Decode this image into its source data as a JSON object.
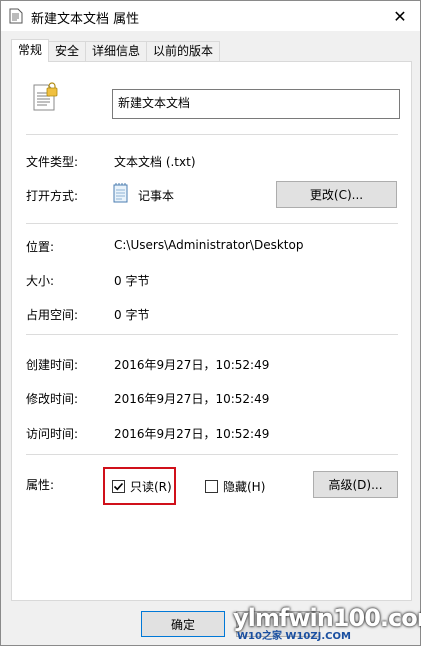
{
  "window": {
    "title": "新建文本文档 属性",
    "close_glyph": "✕"
  },
  "tabs": [
    {
      "label": "常规",
      "active": true
    },
    {
      "label": "安全",
      "active": false
    },
    {
      "label": "详细信息",
      "active": false
    },
    {
      "label": "以前的版本",
      "active": false
    }
  ],
  "general": {
    "file_name": "新建文本文档",
    "file_type_label": "文件类型:",
    "file_type_value": "文本文档 (.txt)",
    "opens_with_label": "打开方式:",
    "opens_with_value": "记事本",
    "change_button": "更改(C)...",
    "location_label": "位置:",
    "location_value": "C:\\Users\\Administrator\\Desktop",
    "size_label": "大小:",
    "size_value": "0 字节",
    "size_on_disk_label": "占用空间:",
    "size_on_disk_value": "0 字节",
    "created_label": "创建时间:",
    "created_value": "2016年9月27日，10:52:49",
    "modified_label": "修改时间:",
    "modified_value": "2016年9月27日，10:52:49",
    "accessed_label": "访问时间:",
    "accessed_value": "2016年9月27日，10:52:49",
    "attributes_label": "属性:",
    "readonly_label": "只读(R)",
    "readonly_checked": true,
    "hidden_label": "隐藏(H)",
    "hidden_checked": false,
    "advanced_button": "高级(D)..."
  },
  "footer": {
    "ok_button": "确定"
  },
  "watermark": {
    "line1": "ylmfwin100.com",
    "line2": "W10之家 W10ZJ.COM"
  },
  "colors": {
    "highlight": "#d0101a",
    "panel_bg": "#ffffff",
    "window_bg": "#f0f0f0",
    "button_bg": "#e1e1e1"
  },
  "icons": {
    "title": "text-file-icon",
    "file": "text-file-lock-icon",
    "opens_with": "notepad-icon",
    "check": "checkmark-icon"
  }
}
